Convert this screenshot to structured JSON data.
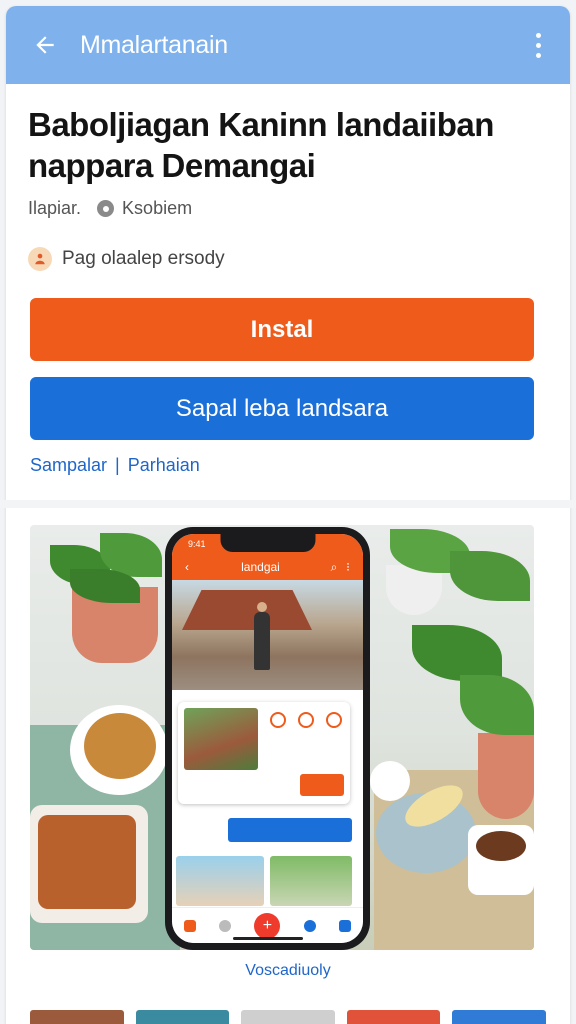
{
  "appbar": {
    "title": "Mmalartanain",
    "back_icon": "arrow-left-icon",
    "menu_icon": "more-vertical-icon",
    "color": "#7fb2ec"
  },
  "app": {
    "title": "Baboljiagan Kaninn landaiiban nappara Demangai",
    "developer": "Ilapiar.",
    "category": "Ksobiem",
    "rating_text": "Pag olaalep ersody"
  },
  "buttons": {
    "install_label": "Instal",
    "install_color": "#ef5b1b",
    "secondary_label": "Sapal leba landsara",
    "secondary_color": "#1a6fd9"
  },
  "links": {
    "first": "Sampalar",
    "separator": "|",
    "second": "Parhaian"
  },
  "screenshot": {
    "phone_time": "9:41",
    "phone_title": "landgai",
    "caption": "Voscadiuoly"
  }
}
